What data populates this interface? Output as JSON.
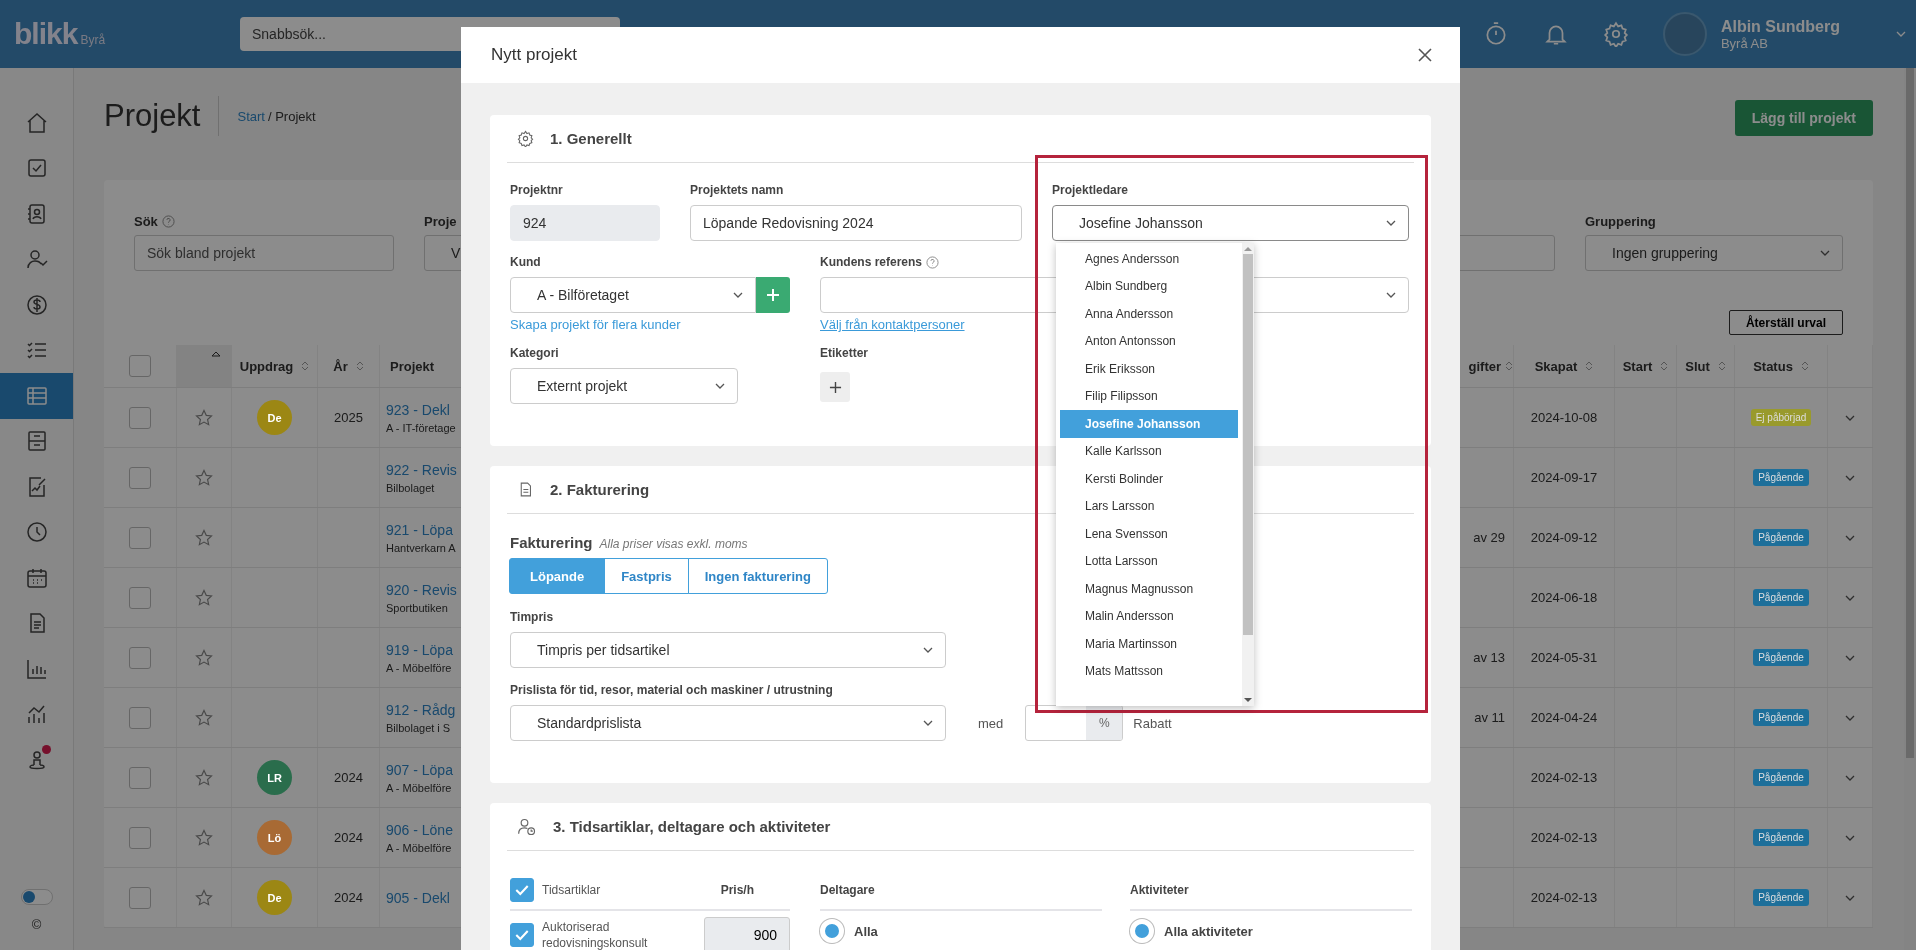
{
  "header": {
    "logo": "blikk",
    "logo_suffix": "Byrå",
    "search": {
      "placeholder": "Snabbsök..."
    },
    "user": {
      "name": "Albin Sundberg",
      "company": "Byrå AB"
    }
  },
  "sidebar": {
    "items": [
      {
        "kind": "home",
        "selected": false
      },
      {
        "kind": "checkbox",
        "selected": false
      },
      {
        "kind": "contacts",
        "selected": false
      },
      {
        "kind": "user-check",
        "selected": false
      },
      {
        "kind": "dollar",
        "selected": false
      },
      {
        "kind": "tasks",
        "selected": false
      },
      {
        "kind": "table",
        "selected": true
      },
      {
        "kind": "archive",
        "selected": false
      },
      {
        "kind": "chart-doc",
        "selected": false
      },
      {
        "kind": "clock",
        "selected": false
      },
      {
        "kind": "calendar",
        "selected": false
      },
      {
        "kind": "document",
        "selected": false
      },
      {
        "kind": "bars",
        "selected": false
      },
      {
        "kind": "trend",
        "selected": false
      },
      {
        "kind": "person-pin",
        "selected": false
      }
    ],
    "toggle_on": false,
    "copyright": "©"
  },
  "page": {
    "title": "Projekt",
    "breadcrumb_link": "Start",
    "breadcrumb_current": "/ Projekt",
    "add_button": "Lägg till projekt"
  },
  "filters": {
    "search": {
      "label": "Sök",
      "placeholder": "Sök bland projekt"
    },
    "project_filter": {
      "label": "Proje",
      "value": "V"
    },
    "grouping": {
      "label": "Gruppering",
      "value": "Ingen gruppering"
    },
    "reset_button": "Återställ urval"
  },
  "table": {
    "select_all_checked": false,
    "columns_left": [
      "Uppdrag",
      "År",
      "Projekt"
    ],
    "columns_right": [
      "gifter",
      "Skapat",
      "Start",
      "Slut",
      "Status"
    ],
    "rows": [
      {
        "checked": false,
        "starred": false,
        "badge": {
          "initials": "De",
          "color": "#9c8714"
        },
        "year": "2025",
        "project": "923 - Dekl",
        "client": "A - IT-företage",
        "progress": "",
        "created": "2024-10-08",
        "status": {
          "label": "Ej påbörjad",
          "color": "#999a2c"
        }
      },
      {
        "checked": false,
        "starred": false,
        "year": "",
        "project": "922 - Revis",
        "client": "Bilbolaget",
        "progress": "",
        "created": "2024-09-17",
        "status": {
          "label": "Pågående",
          "color": "#1d6f9a"
        }
      },
      {
        "checked": false,
        "starred": false,
        "year": "",
        "project": "921 - Löpa",
        "client": "Hantverkarn A",
        "progress": "av 29",
        "created": "2024-09-12",
        "status": {
          "label": "Pågående",
          "color": "#1d6f9a"
        }
      },
      {
        "checked": false,
        "starred": false,
        "year": "",
        "project": "920 - Revis",
        "client": "Sportbutiken",
        "progress": "",
        "created": "2024-06-18",
        "status": {
          "label": "Pågående",
          "color": "#1d6f9a"
        }
      },
      {
        "checked": false,
        "starred": false,
        "year": "",
        "project": "919 - Löpa",
        "client": "A - Möbelföre",
        "progress": "av 13",
        "created": "2024-05-31",
        "status": {
          "label": "Pågående",
          "color": "#1d6f9a"
        }
      },
      {
        "checked": false,
        "starred": false,
        "year": "",
        "project": "912 - Rådg",
        "client": "Bilbolaget i S",
        "progress": "av 11",
        "created": "2024-04-24",
        "status": {
          "label": "Pågående",
          "color": "#1d6f9a"
        }
      },
      {
        "checked": false,
        "starred": false,
        "badge": {
          "initials": "LR",
          "color": "#2a6d4c"
        },
        "year": "2024",
        "project": "907 - Löpa",
        "client": "A - Möbelföre",
        "progress": "",
        "created": "2024-02-13",
        "status": {
          "label": "Pågående",
          "color": "#1d6f9a"
        }
      },
      {
        "checked": false,
        "starred": false,
        "badge": {
          "initials": "Lö",
          "color": "#a86a34"
        },
        "year": "2024",
        "project": "906 - Löne",
        "client": "A - Möbelföre",
        "progress": "",
        "created": "2024-02-13",
        "status": {
          "label": "Pågående",
          "color": "#1d6f9a"
        }
      },
      {
        "checked": false,
        "starred": false,
        "badge": {
          "initials": "De",
          "color": "#9c8714"
        },
        "year": "2024",
        "project": "905 - Dekl",
        "progress": "",
        "created": "2024-02-13",
        "status": {
          "label": "Pågående",
          "color": "#1d6f9a"
        }
      }
    ]
  },
  "modal": {
    "title": "Nytt projekt",
    "general": {
      "title": "1. Generellt",
      "project_number": {
        "label": "Projektnr",
        "value": "924"
      },
      "project_name": {
        "label": "Projektets namn",
        "value": "Löpande Redovisning 2024"
      },
      "project_manager": {
        "label": "Projektledare",
        "value": "Josefine Johansson",
        "expanded": true,
        "highlighted": true,
        "options": [
          {
            "label": "Agnes Andersson",
            "selected": false
          },
          {
            "label": "Albin Sundberg",
            "selected": false
          },
          {
            "label": "Anna Andersson",
            "selected": false
          },
          {
            "label": "Anton Antonsson",
            "selected": false
          },
          {
            "label": "Erik Eriksson",
            "selected": false
          },
          {
            "label": "Filip Filipsson",
            "selected": false
          },
          {
            "label": "Josefine Johansson",
            "selected": true
          },
          {
            "label": "Kalle Karlsson",
            "selected": false
          },
          {
            "label": "Kersti Bolinder",
            "selected": false
          },
          {
            "label": "Lars Larsson",
            "selected": false
          },
          {
            "label": "Lena Svensson",
            "selected": false
          },
          {
            "label": "Lotta Larsson",
            "selected": false
          },
          {
            "label": "Magnus Magnusson",
            "selected": false
          },
          {
            "label": "Malin Andersson",
            "selected": false
          },
          {
            "label": "Maria Martinsson",
            "selected": false
          },
          {
            "label": "Mats Mattsson",
            "selected": false
          }
        ]
      },
      "customer": {
        "label": "Kund",
        "value": "A - Bilföretaget",
        "link": "Skapa projekt för flera kunder"
      },
      "customer_reference": {
        "label": "Kundens referens",
        "link": "Välj från kontaktpersoner"
      },
      "category": {
        "label": "Kategori",
        "value": "Externt projekt"
      },
      "tags": {
        "label": "Etiketter"
      }
    },
    "invoicing": {
      "title": "2. Fakturering",
      "label": "Fakturering",
      "note": "Alla priser visas exkl. moms",
      "modes": [
        {
          "label": "Löpande",
          "selected": true
        },
        {
          "label": "Fastpris",
          "selected": false
        },
        {
          "label": "Ingen fakturering",
          "selected": false
        }
      ],
      "hourly_rate": {
        "label": "Timpris",
        "value": "Timpris per tidsartikel"
      },
      "price_list": {
        "label": "Prislista för tid, resor, material och maskiner / utrustning",
        "value": "Standardprislista"
      },
      "discount": {
        "prefix": "med",
        "unit": "%",
        "suffix": "Rabatt"
      }
    },
    "time_articles": {
      "title": "3. Tidsartiklar, deltagare och aktiviteter",
      "articles_header": {
        "label": "Tidsartiklar",
        "checked": true
      },
      "price_header": "Pris/h",
      "articles": [
        {
          "label": "Auktoriserad redovisningskonsult",
          "checked": true,
          "price": "900"
        }
      ],
      "participants": {
        "label": "Deltagare",
        "options": [
          {
            "label": "Alla",
            "selected": true
          }
        ]
      },
      "activities": {
        "label": "Aktiviteter",
        "options": [
          {
            "label": "Alla aktiviteter",
            "selected": true
          }
        ]
      }
    }
  }
}
